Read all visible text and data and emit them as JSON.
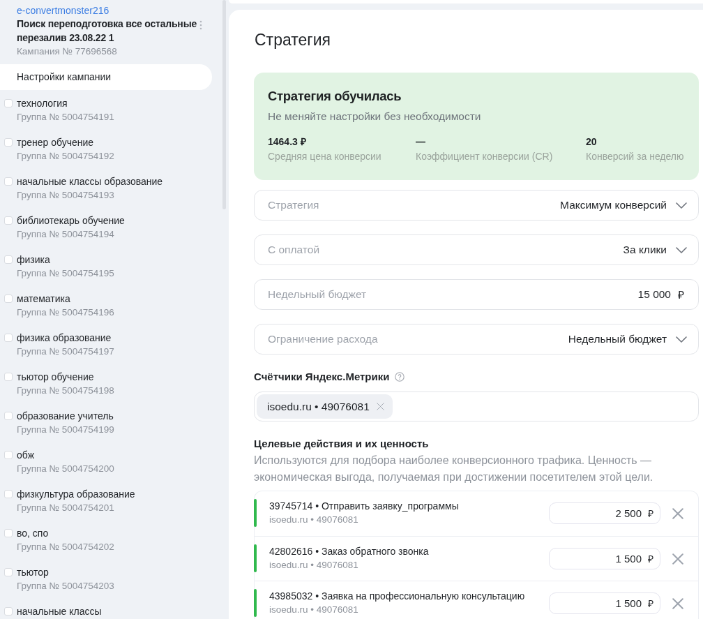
{
  "sidebar": {
    "account": "e-convertmonster216",
    "campaign_title": "Поиск переподготовка все остальные перезалив 23.08.22 1",
    "campaign_number": "Кампания № 77696568",
    "items": [
      {
        "kind": "settings",
        "label": "Настройки кампании",
        "selected": true
      },
      {
        "kind": "group",
        "label": "технология",
        "number": "Группа № 5004754191",
        "checked": false,
        "selected": false
      },
      {
        "kind": "group",
        "label": "тренер обучение",
        "number": "Группа № 5004754192",
        "checked": false,
        "selected": false
      },
      {
        "kind": "group",
        "label": "начальные классы образование",
        "number": "Группа № 5004754193",
        "checked": false,
        "selected": false
      },
      {
        "kind": "group",
        "label": "библиотекарь обучение",
        "number": "Группа № 5004754194",
        "checked": false,
        "selected": false
      },
      {
        "kind": "group",
        "label": "физика",
        "number": "Группа № 5004754195",
        "checked": false,
        "selected": false
      },
      {
        "kind": "group",
        "label": "математика",
        "number": "Группа № 5004754196",
        "checked": false,
        "selected": false
      },
      {
        "kind": "group",
        "label": "физика образование",
        "number": "Группа № 5004754197",
        "checked": false,
        "selected": false
      },
      {
        "kind": "group",
        "label": "тьютор обучение",
        "number": "Группа № 5004754198",
        "checked": false,
        "selected": false
      },
      {
        "kind": "group",
        "label": "образование учитель",
        "number": "Группа № 5004754199",
        "checked": false,
        "selected": false
      },
      {
        "kind": "group",
        "label": "обж",
        "number": "Группа № 5004754200",
        "checked": false,
        "selected": false
      },
      {
        "kind": "group",
        "label": "физкультура образование",
        "number": "Группа № 5004754201",
        "checked": false,
        "selected": false
      },
      {
        "kind": "group",
        "label": "во, спо",
        "number": "Группа № 5004754202",
        "checked": false,
        "selected": false
      },
      {
        "kind": "group",
        "label": "тьютор",
        "number": "Группа № 5004754203",
        "checked": false,
        "selected": false
      },
      {
        "kind": "group",
        "label": "начальные классы",
        "checked": false,
        "selected": false
      }
    ]
  },
  "main": {
    "title": "Стратегия",
    "status_panel": {
      "title": "Стратегия обучилась",
      "subtitle": "Не меняйте настройки без необходимости",
      "stats": [
        {
          "value": "1464.3 ₽",
          "label": "Средняя цена конверсии"
        },
        {
          "value": "—",
          "label": "Коэффициент конверсии (CR)"
        },
        {
          "value": "20",
          "label": "Конверсий за неделю"
        }
      ]
    },
    "fields": [
      {
        "kind": "select",
        "label": "Стратегия",
        "value": "Максимум конверсий"
      },
      {
        "kind": "select",
        "label": "С оплатой",
        "value": "За клики"
      },
      {
        "kind": "input",
        "label": "Недельный бюджет",
        "value": "15 000",
        "unit": "₽"
      },
      {
        "kind": "select",
        "label": "Ограничение расхода",
        "value": "Недельный бюджет"
      }
    ],
    "counters": {
      "title": "Счётчики Яндекс.Метрики",
      "tags": [
        "isoedu.ru • 49076081"
      ]
    },
    "goals": {
      "title": "Целевые действия и их ценность",
      "description": "Используются для подбора наиболее конверсионного трафика. Ценность — экономическая выгода, получаемая при достижении посетителем этой цели.",
      "items": [
        {
          "name": "39745714 • Отправить заявку_программы",
          "counter": "isoedu.ru • 49076081",
          "value": "2 500",
          "unit": "₽"
        },
        {
          "name": "42802616 • Заказ обратного звонка",
          "counter": "isoedu.ru • 49076081",
          "value": "1 500",
          "unit": "₽"
        },
        {
          "name": "43985032 • Заявка на профессиональную консультацию",
          "counter": "isoedu.ru • 49076081",
          "value": "1 500",
          "unit": "₽"
        }
      ]
    }
  }
}
